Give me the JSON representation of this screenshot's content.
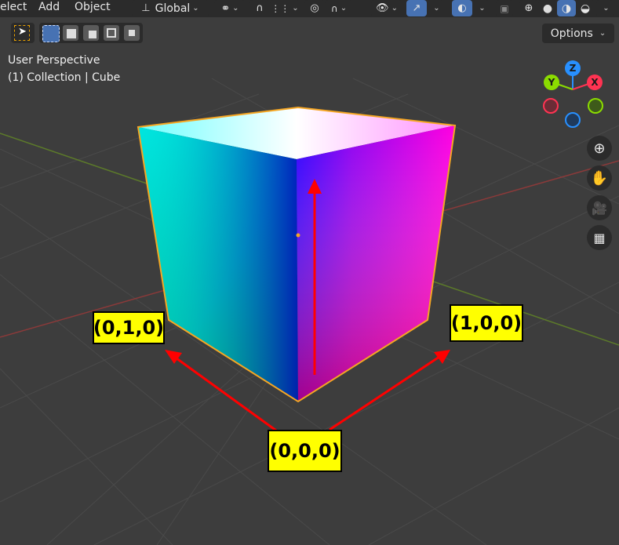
{
  "header": {
    "menu": {
      "select": "elect",
      "add": "Add",
      "object": "Object"
    },
    "transform_orientation": "Global",
    "options_label": "Options"
  },
  "viewport": {
    "view_name": "User Perspective",
    "collection_label": "(1) Collection | Cube"
  },
  "gizmo": {
    "x": "X",
    "y": "Y",
    "z": "Z"
  },
  "annotations": {
    "origin": "(0,0,0)",
    "x_corner": "(1,0,0)",
    "y_corner": "(0,1,0)"
  },
  "colors": {
    "background": "#3d3d3d",
    "selection_outline": "#f5a623",
    "arrow": "#ff0000",
    "label_bg": "#ffff00",
    "axis_x": "#ff3352",
    "axis_y": "#8bdc00",
    "axis_z": "#2890ff"
  }
}
